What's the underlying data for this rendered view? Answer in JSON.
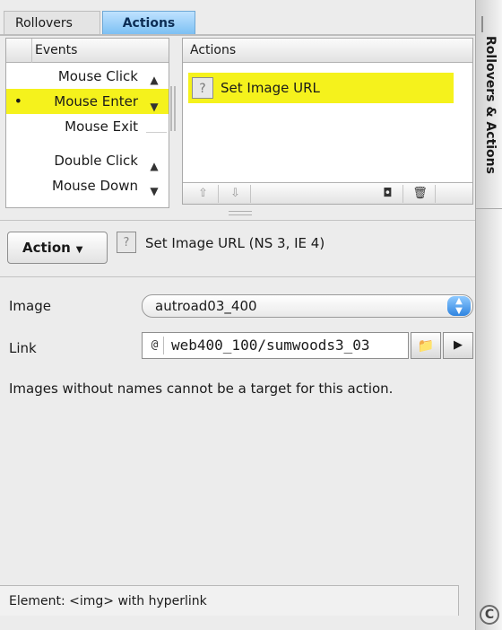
{
  "tabs": {
    "rollovers": "Rollovers",
    "actions": "Actions"
  },
  "events": {
    "header": "Events",
    "items": [
      {
        "label": "Mouse Click",
        "selected": false
      },
      {
        "label": "Mouse Enter",
        "selected": true,
        "bullet": "•"
      },
      {
        "label": "Mouse Exit",
        "selected": false
      },
      {
        "label": "Double Click",
        "selected": false
      },
      {
        "label": "Mouse Down",
        "selected": false
      }
    ]
  },
  "actions_list": {
    "header": "Actions",
    "items": [
      {
        "label": "Set Image URL",
        "icon": "question-icon"
      }
    ]
  },
  "action_menu": {
    "label": "Action"
  },
  "action_desc": "Set Image URL (NS 3, IE 4)",
  "image": {
    "label": "Image",
    "value": "autroad03_400"
  },
  "link": {
    "label": "Link",
    "value": "web400_100/sumwoods3_03"
  },
  "hint": "Images without names cannot be a target for this action.",
  "status": "Element: <img> with hyperlink",
  "drawer": {
    "title": "Rollovers & Actions"
  },
  "icons": {
    "action_icon": "?",
    "up_arrow": "▲",
    "down_arrow": "▼",
    "move_up": "⇧",
    "move_down": "⇩",
    "trash": "🗑",
    "link_type": "@",
    "browse": "📁",
    "menu": "▶",
    "collapse": "C"
  },
  "colors": {
    "selection": "#f5f21c",
    "tab_active": "#7cc0f3"
  }
}
